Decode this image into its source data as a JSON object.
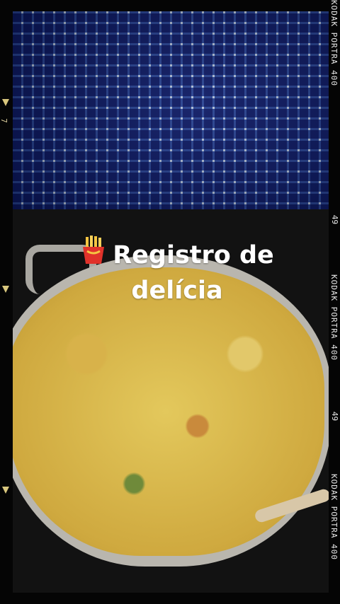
{
  "caption": {
    "line1": "Registro de",
    "line2": "delícia",
    "emoji_icon": "fries-icon"
  },
  "film_strip": {
    "labels": [
      "KODAK PORTRA 400",
      "KODAK PORTRA 400",
      "KODAK PORTRA 400"
    ],
    "frame_numbers": [
      "49",
      "49"
    ],
    "left_number": "7"
  },
  "colors": {
    "tile_blue": "#2b4aa0",
    "soup_yellow": "#e3c85c",
    "text": "#ffffff"
  }
}
